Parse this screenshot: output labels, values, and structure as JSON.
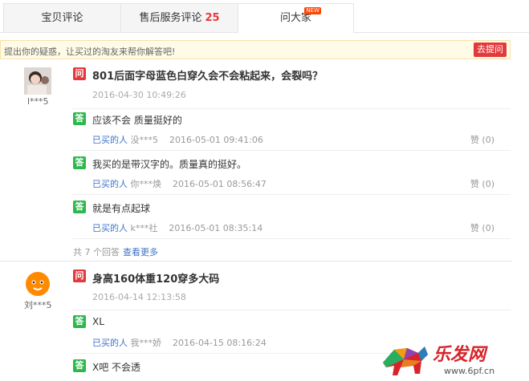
{
  "tabs": [
    {
      "label": "宝贝评论",
      "count": ""
    },
    {
      "label": "售后服务评论",
      "count": "25"
    },
    {
      "label": "问大家",
      "count": "",
      "badge": "NEW"
    }
  ],
  "ask_bar": {
    "prompt": "提出你的疑惑，让买过的淘友来帮你解答吧!",
    "button": "去提问"
  },
  "questions": [
    {
      "user": "l***5",
      "question": "801后面字母蓝色白穿久会不会粘起来，会裂吗？",
      "time": "2016-04-30 10:49:26",
      "answers": [
        {
          "text": "应该不会 质量挺好的",
          "buyer_label": "已买的人",
          "user": "没***5",
          "time": "2016-05-01 09:41:06",
          "like": "赞 (0)"
        },
        {
          "text": "我买的是带汉字的。质量真的挺好。",
          "buyer_label": "已买的人",
          "user": "你***焕",
          "time": "2016-05-01 08:56:47",
          "like": "赞 (0)"
        },
        {
          "text": "就是有点起球",
          "buyer_label": "已买的人",
          "user": "k***社",
          "time": "2016-05-01 08:35:14",
          "like": "赞 (0)"
        }
      ],
      "total": "共 7 个回答",
      "more": "查看更多"
    },
    {
      "user": "刘***5",
      "question": "身高160体重120穿多大码",
      "time": "2016-04-14 12:13:58",
      "answers": [
        {
          "text": "XL",
          "buyer_label": "已买的人",
          "user": "我***娇",
          "time": "2016-04-15 08:16:24",
          "like": ""
        },
        {
          "text": "X吧 不会透",
          "buyer_label": "",
          "user": "",
          "time": "",
          "like": ""
        }
      ]
    }
  ],
  "badges": {
    "q": "问",
    "a": "答"
  },
  "watermark": {
    "brand": "乐发网",
    "url": "www.6pf.cn"
  }
}
